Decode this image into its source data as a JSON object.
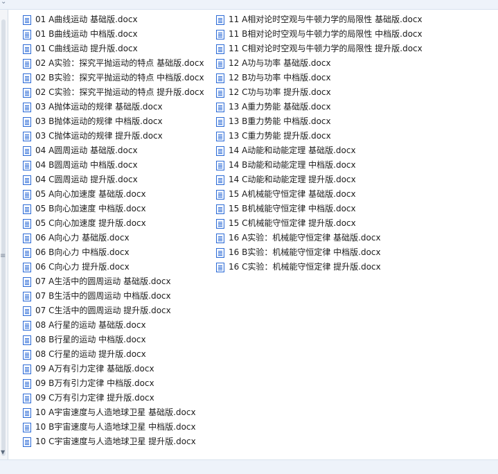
{
  "ui": {
    "top_arrow": "⌄",
    "left_grip": "≡"
  },
  "files": {
    "left": [
      "01 A曲线运动 基础版.docx",
      "01 B曲线运动 中档版.docx",
      "01 C曲线运动 提升版.docx",
      "02 A实验：探究平抛运动的特点 基础版.docx",
      "02 B实验：探究平抛运动的特点 中档版.docx",
      "02 C实验：探究平抛运动的特点 提升版.docx",
      "03 A抛体运动的规律 基础版.docx",
      "03 B抛体运动的规律 中档版.docx",
      "03 C抛体运动的规律 提升版.docx",
      "04 A圆周运动 基础版.docx",
      "04 B圆周运动 中档版.docx",
      "04 C圆周运动 提升版.docx",
      "05 A向心加速度 基础版.docx",
      "05 B向心加速度 中档版.docx",
      "05 C向心加速度 提升版.docx",
      "06 A向心力 基础版.docx",
      "06 B向心力 中档版.docx",
      "06 C向心力 提升版.docx",
      "07 A生活中的圆周运动 基础版.docx",
      "07 B生活中的圆周运动 中档版.docx",
      "07 C生活中的圆周运动 提升版.docx",
      "08 A行星的运动 基础版.docx",
      "08 B行星的运动 中档版.docx",
      "08 C行星的运动 提升版.docx",
      "09 A万有引力定律 基础版.docx",
      "09 B万有引力定律 中档版.docx",
      "09 C万有引力定律 提升版.docx",
      "10 A宇宙速度与人造地球卫星 基础版.docx",
      "10 B宇宙速度与人造地球卫星 中档版.docx",
      "10 C宇宙速度与人造地球卫星 提升版.docx"
    ],
    "right": [
      "11 A相对论时空观与牛顿力学的局限性 基础版.docx",
      "11 B相对论时空观与牛顿力学的局限性 中档版.docx",
      "11 C相对论时空观与牛顿力学的局限性 提升版.docx",
      "12 A功与功率 基础版.docx",
      "12 B功与功率 中档版.docx",
      "12 C功与功率 提升版.docx",
      "13 A重力势能 基础版.docx",
      "13 B重力势能 中档版.docx",
      "13 C重力势能 提升版.docx",
      "14 A动能和动能定理 基础版.docx",
      "14 B动能和动能定理 中档版.docx",
      "14 C动能和动能定理 提升版.docx",
      "15 A机械能守恒定律 基础版.docx",
      "15 B机械能守恒定律 中档版.docx",
      "15 C机械能守恒定律 提升版.docx",
      "16 A实验：机械能守恒定律 基础版.docx",
      "16 B实验：机械能守恒定律 中档版.docx",
      "16 C实验：机械能守恒定律 提升版.docx"
    ]
  }
}
